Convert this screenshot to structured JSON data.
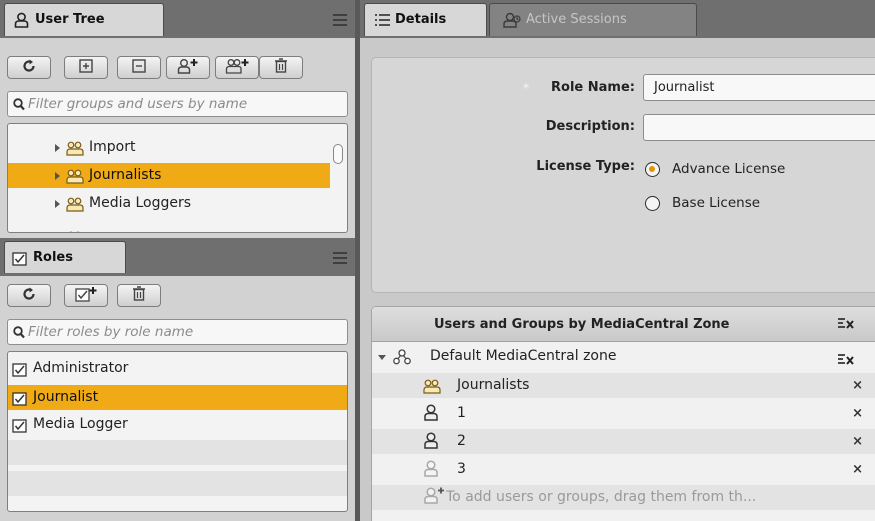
{
  "user_tree_panel": {
    "tab_label": "User Tree",
    "filter_placeholder": "Filter groups and users by name",
    "toolbar_buttons": [
      "refresh-icon",
      "expand-all-icon",
      "collapse-all-icon",
      "add-user-icon",
      "add-group-icon",
      "delete-icon"
    ],
    "items": [
      {
        "label": "Import",
        "icon": "group-icon",
        "selected": false
      },
      {
        "label": "Journalists",
        "icon": "group-icon",
        "selected": true
      },
      {
        "label": "Media Loggers",
        "icon": "group-icon",
        "selected": false
      }
    ]
  },
  "roles_panel": {
    "tab_label": "Roles",
    "filter_placeholder": "Filter roles by role name",
    "toolbar_buttons": [
      "refresh-icon",
      "add-role-icon",
      "delete-icon"
    ],
    "items": [
      {
        "label": "Administrator",
        "icon": "role-icon",
        "selected": false
      },
      {
        "label": "Journalist",
        "icon": "role-icon",
        "selected": true
      },
      {
        "label": "Media Logger",
        "icon": "role-icon",
        "selected": false
      }
    ]
  },
  "details_panel": {
    "tabs": [
      {
        "label": "Details",
        "icon": "list-icon",
        "active": true
      },
      {
        "label": "Active Sessions",
        "icon": "sessions-icon",
        "active": false
      }
    ],
    "required_marker": "*",
    "role_name_label": "Role Name:",
    "role_name_value": "Journalist",
    "description_label": "Description:",
    "description_value": "",
    "license_type_label": "License Type:",
    "license_options": [
      {
        "label": "Advance License",
        "selected": true
      },
      {
        "label": "Base License",
        "selected": false
      }
    ]
  },
  "zone_table": {
    "header": "Users and Groups by MediaCentral Zone",
    "zone_label": "Default MediaCentral zone",
    "members": [
      {
        "label": "Journalists",
        "icon": "group-icon",
        "dim": false
      },
      {
        "label": "1",
        "icon": "user-icon",
        "dim": false
      },
      {
        "label": "2",
        "icon": "user-icon",
        "dim": false
      },
      {
        "label": "3",
        "icon": "user-icon",
        "dim": true
      }
    ],
    "hint": "To add users or groups, drag them from th...",
    "remove_symbol": "×"
  },
  "colors": {
    "selection": "#f0aa15",
    "radio_selected": "#e59400",
    "panel_bg": "#d2d2d2"
  }
}
